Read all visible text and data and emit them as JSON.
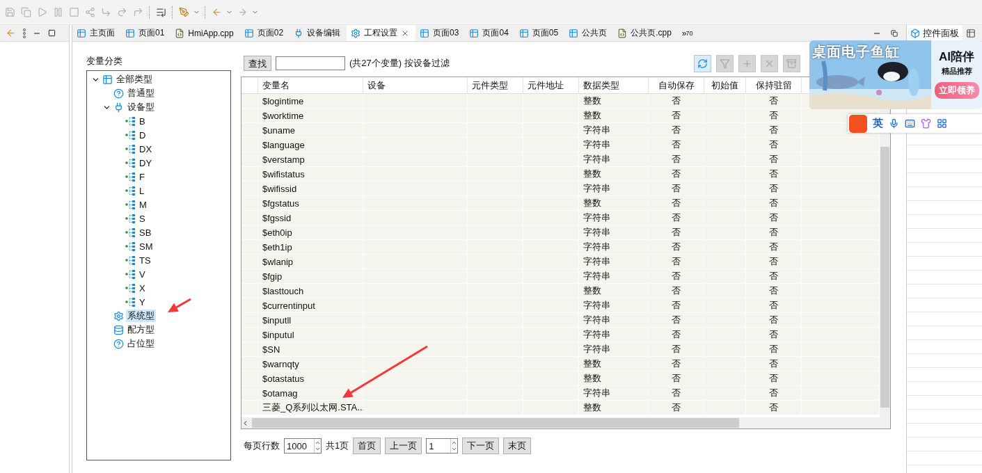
{
  "toolbar": {
    "buttons": [
      {
        "kind": "save",
        "disabled": true
      },
      {
        "kind": "save-all",
        "disabled": true
      },
      {
        "kind": "run",
        "disabled": true
      },
      {
        "kind": "pause",
        "disabled": true
      },
      {
        "kind": "stop",
        "disabled": true
      },
      {
        "kind": "connect",
        "disabled": true
      },
      {
        "kind": "step-into",
        "disabled": true
      },
      {
        "kind": "step-over",
        "disabled": true
      },
      {
        "kind": "step-return",
        "disabled": true
      },
      {
        "kind": "list",
        "disabled": false
      },
      {
        "kind": "brush",
        "disabled": false
      },
      {
        "kind": "back",
        "disabled": false
      },
      {
        "kind": "forward",
        "disabled": true
      }
    ]
  },
  "editor_tabs": [
    {
      "label": "主页面",
      "kind": "page",
      "selected": false
    },
    {
      "label": "页面01",
      "kind": "page",
      "selected": false
    },
    {
      "label": "HmiApp.cpp",
      "kind": "cpp",
      "selected": false
    },
    {
      "label": "页面02",
      "kind": "page",
      "selected": false
    },
    {
      "label": "设备编辑",
      "kind": "device",
      "selected": false
    },
    {
      "label": "工程设置",
      "kind": "settings",
      "selected": true,
      "closable": true
    },
    {
      "label": "页面03",
      "kind": "page",
      "selected": false
    },
    {
      "label": "页面04",
      "kind": "page",
      "selected": false
    },
    {
      "label": "页面05",
      "kind": "page",
      "selected": false
    },
    {
      "label": "公共页",
      "kind": "page",
      "selected": false
    },
    {
      "label": "公共页.cpp",
      "kind": "cpp",
      "selected": false
    }
  ],
  "tab_overflow": {
    "symbol": "»",
    "count": "70"
  },
  "right_panel": {
    "tabs": [
      {
        "label": "控件面板",
        "kind": "cube",
        "selected": true
      },
      {
        "kind": "table",
        "selected": false
      }
    ]
  },
  "category_panel": {
    "title": "变量分类",
    "tree": [
      {
        "label": "全部类型",
        "kind": "all",
        "expanded": true,
        "selected": false,
        "children": [
          {
            "label": "普通型",
            "kind": "normal",
            "selected": false
          },
          {
            "label": "设备型",
            "kind": "device",
            "expanded": true,
            "selected": false,
            "children": [
              {
                "label": "B",
                "kind": "register",
                "selected": false
              },
              {
                "label": "D",
                "kind": "register",
                "selected": false
              },
              {
                "label": "DX",
                "kind": "register",
                "selected": false
              },
              {
                "label": "DY",
                "kind": "register",
                "selected": false
              },
              {
                "label": "F",
                "kind": "register",
                "selected": false
              },
              {
                "label": "L",
                "kind": "register",
                "selected": false
              },
              {
                "label": "M",
                "kind": "register",
                "selected": false
              },
              {
                "label": "S",
                "kind": "register",
                "selected": false
              },
              {
                "label": "SB",
                "kind": "register",
                "selected": false
              },
              {
                "label": "SM",
                "kind": "register",
                "selected": false
              },
              {
                "label": "TS",
                "kind": "register",
                "selected": false
              },
              {
                "label": "V",
                "kind": "register",
                "selected": false
              },
              {
                "label": "X",
                "kind": "register",
                "selected": false
              },
              {
                "label": "Y",
                "kind": "register",
                "selected": false
              }
            ]
          },
          {
            "label": "系统型",
            "kind": "system",
            "selected": true
          },
          {
            "label": "配方型",
            "kind": "recipe",
            "selected": false
          },
          {
            "label": "占位型",
            "kind": "normal",
            "selected": false
          }
        ]
      }
    ]
  },
  "search": {
    "button": "查找",
    "summary": "(共27个变量) 按设备过滤"
  },
  "table_actions": [
    {
      "kind": "refresh",
      "disabled": false
    },
    {
      "kind": "filter-add",
      "disabled": true
    },
    {
      "kind": "add",
      "disabled": true
    },
    {
      "kind": "delete",
      "disabled": true
    },
    {
      "kind": "export",
      "disabled": true
    }
  ],
  "table": {
    "columns": [
      "变量名",
      "设备",
      "元件类型",
      "元件地址",
      "数据类型",
      "自动保存",
      "初始值",
      "保持驻留"
    ],
    "rows": [
      {
        "name": "$logintime",
        "data_type": "整数",
        "auto_save": "否",
        "retain": "否"
      },
      {
        "name": "$worktime",
        "data_type": "整数",
        "auto_save": "否",
        "retain": "否"
      },
      {
        "name": "$uname",
        "data_type": "字符串",
        "auto_save": "否",
        "retain": "否"
      },
      {
        "name": "$language",
        "data_type": "字符串",
        "auto_save": "否",
        "retain": "否"
      },
      {
        "name": "$verstamp",
        "data_type": "字符串",
        "auto_save": "否",
        "retain": "否"
      },
      {
        "name": "$wifistatus",
        "data_type": "整数",
        "auto_save": "否",
        "retain": "否"
      },
      {
        "name": "$wifissid",
        "data_type": "字符串",
        "auto_save": "否",
        "retain": "否"
      },
      {
        "name": "$fgstatus",
        "data_type": "整数",
        "auto_save": "否",
        "retain": "否"
      },
      {
        "name": "$fgssid",
        "data_type": "字符串",
        "auto_save": "否",
        "retain": "否"
      },
      {
        "name": "$eth0ip",
        "data_type": "字符串",
        "auto_save": "否",
        "retain": "否"
      },
      {
        "name": "$eth1ip",
        "data_type": "字符串",
        "auto_save": "否",
        "retain": "否"
      },
      {
        "name": "$wlanip",
        "data_type": "字符串",
        "auto_save": "否",
        "retain": "否"
      },
      {
        "name": "$fgip",
        "data_type": "字符串",
        "auto_save": "否",
        "retain": "否"
      },
      {
        "name": "$lasttouch",
        "data_type": "整数",
        "auto_save": "否",
        "retain": "否"
      },
      {
        "name": "$currentinput",
        "data_type": "字符串",
        "auto_save": "否",
        "retain": "否"
      },
      {
        "name": "$inputll",
        "data_type": "字符串",
        "auto_save": "否",
        "retain": "否"
      },
      {
        "name": "$inputul",
        "data_type": "字符串",
        "auto_save": "否",
        "retain": "否"
      },
      {
        "name": "$SN",
        "data_type": "字符串",
        "auto_save": "否",
        "retain": "否"
      },
      {
        "name": "$warnqty",
        "data_type": "整数",
        "auto_save": "否",
        "retain": "否"
      },
      {
        "name": "$otastatus",
        "data_type": "整数",
        "auto_save": "否",
        "retain": "否"
      },
      {
        "name": "$otamag",
        "data_type": "字符串",
        "auto_save": "否",
        "retain": "否"
      },
      {
        "name": "三菱_Q系列以太网.STA...",
        "data_type": "整数",
        "auto_save": "否",
        "retain": "否"
      }
    ]
  },
  "pager": {
    "rows_label": "每页行数",
    "rows_per_page": "1000",
    "total": "共1页",
    "first": "首页",
    "prev": "上一页",
    "page": "1",
    "next": "下一页",
    "last": "末页"
  },
  "popup_ad": {
    "title": "桌面电子鱼缸",
    "heading": "AI陪伴",
    "subheading": "精品推荐",
    "action": "立即领养"
  },
  "ime_bar": {
    "mode": "英"
  },
  "annotations": [
    {
      "kind": "arrow"
    },
    {
      "kind": "arrow"
    }
  ]
}
